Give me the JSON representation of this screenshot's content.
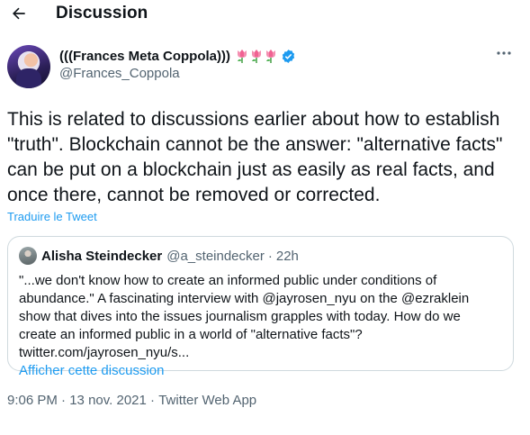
{
  "header": {
    "title": "Discussion",
    "back_icon": "arrow-left-icon"
  },
  "tweet": {
    "display_name": "(((Frances Meta Coppola)))",
    "handle": "@Frances_Coppola",
    "badges": [
      "tulip-icon",
      "tulip-icon",
      "tulip-icon",
      "verified-badge-icon"
    ],
    "text": "This is related to discussions earlier about how to establish \"truth\". Blockchain cannot be the answer: \"alternative facts\" can be put on a blockchain just as easily as real facts, and once there, cannot be removed or corrected.",
    "translate_label": "Traduire le Tweet",
    "more_icon": "more-horizontal-icon",
    "time": "9:06 PM",
    "date": "13 nov. 2021",
    "source": "Twitter Web App",
    "separator": "·"
  },
  "quoted": {
    "name": "Alisha Steindecker",
    "handle": "@a_steindecker",
    "separator": "·",
    "time": "22h",
    "text": "\"...we don't know how to create an informed public under conditions of abundance.\" A fascinating interview with @jayrosen_nyu on the @ezraklein show that dives into the issues journalism grapples with today. How do we create an informed public in a world of \"alternative facts\"? twitter.com/jayrosen_nyu/s...",
    "show_thread_label": "Afficher cette discussion"
  },
  "colors": {
    "link": "#1d9bf0",
    "text": "#0f1419",
    "secondary": "#536471",
    "border": "#cfd9de"
  }
}
